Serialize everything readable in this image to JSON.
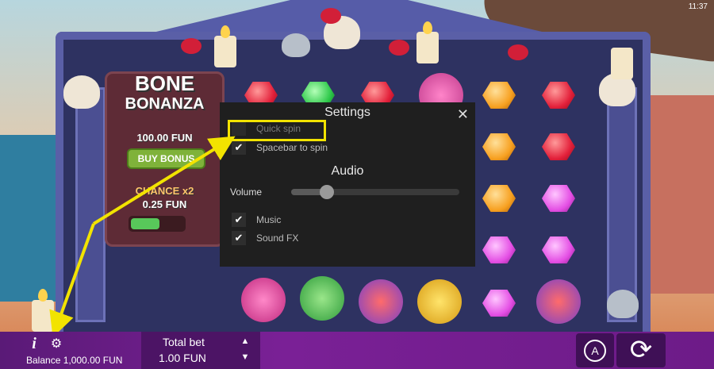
{
  "status": {
    "time": "11:37"
  },
  "game": {
    "logo_line1": "BONE",
    "logo_line2": "BONANZA",
    "buy_amount": "100.00 FUN",
    "buy_label": "BUY BONUS",
    "chance_label": "CHANCE x2",
    "chance_amount": "0.25 FUN"
  },
  "settings": {
    "title": "Settings",
    "close_icon": "close-icon",
    "options": [
      {
        "label": "Quick spin",
        "checked": false
      },
      {
        "label": "Spacebar to spin",
        "checked": true
      }
    ],
    "audio_title": "Audio",
    "volume_label": "Volume",
    "volume_level": 0.21,
    "audio_options": [
      {
        "label": "Music",
        "checked": true
      },
      {
        "label": "Sound FX",
        "checked": true
      }
    ]
  },
  "bottom_bar": {
    "info_icon": "info-icon",
    "settings_icon": "gear-icon",
    "balance": "Balance 1,000.00 FUN",
    "total_bet_label": "Total bet",
    "total_bet_value": "1.00 FUN",
    "autoplay_letter": "A"
  },
  "colors": {
    "highlight": "#f2e300",
    "bar": "#7a2096",
    "modal_bg": "#1f1f1f"
  }
}
